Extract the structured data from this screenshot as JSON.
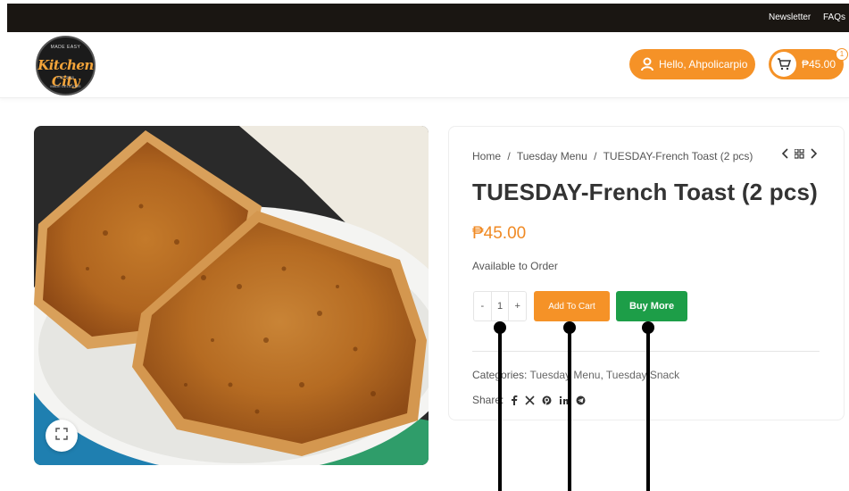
{
  "topbar": {
    "newsletter": "Newsletter",
    "faqs": "FAQs"
  },
  "logo": {
    "top_text": "MADE EASY",
    "main_text": "Kitchen City",
    "mid_text": "EST. 2018",
    "bottom_text": "MADE DELICIOUS"
  },
  "header": {
    "hello": "Hello, Ahpolicarpio",
    "cart_total": "₱45.00",
    "cart_count": "1"
  },
  "breadcrumb": {
    "home": "Home",
    "sep1": "/",
    "menu": "Tuesday Menu",
    "sep2": "/",
    "current": "TUESDAY-French Toast (2 pcs)"
  },
  "product": {
    "title": "TUESDAY-French Toast (2 pcs)",
    "price": "₱45.00",
    "availability": "Available to Order",
    "quantity": "1",
    "qty_minus": "-",
    "qty_plus": "+",
    "add_to_cart": "Add To Cart",
    "buy_more": "Buy More",
    "categories_label": "Categories:",
    "categories": [
      "Tuesday Menu",
      "Tuesday Snack"
    ],
    "cat_sep": ",",
    "share_label": "Share:"
  },
  "icons": {
    "user": "user-icon",
    "cart": "cart-icon",
    "zoom": "expand-icon",
    "prev": "chevron-left-icon",
    "grid": "grid-icon",
    "next": "chevron-right-icon",
    "share": [
      "facebook-icon",
      "x-icon",
      "pinterest-icon",
      "linkedin-icon",
      "telegram-icon"
    ]
  },
  "colors": {
    "accent": "#f59227",
    "green": "#1d9e48",
    "topbar": "#1a1612",
    "price": "#f08a24"
  }
}
